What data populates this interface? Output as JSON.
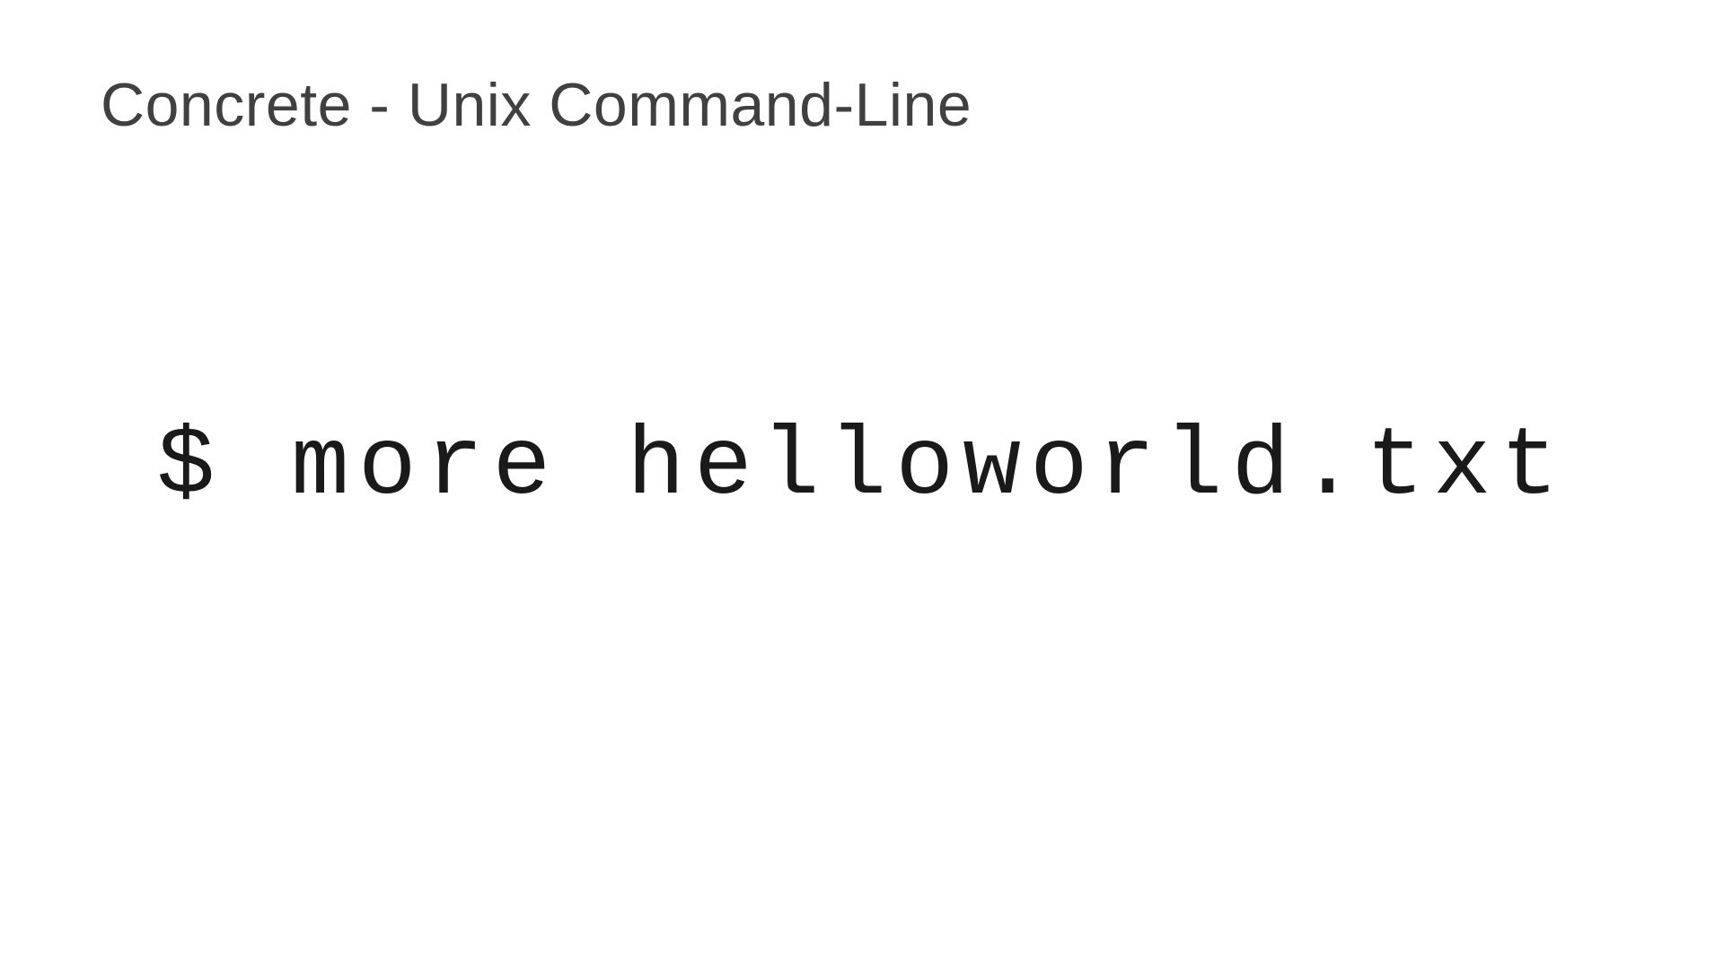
{
  "slide": {
    "title": "Concrete - Unix Command-Line",
    "command": "$ more helloworld.txt"
  }
}
